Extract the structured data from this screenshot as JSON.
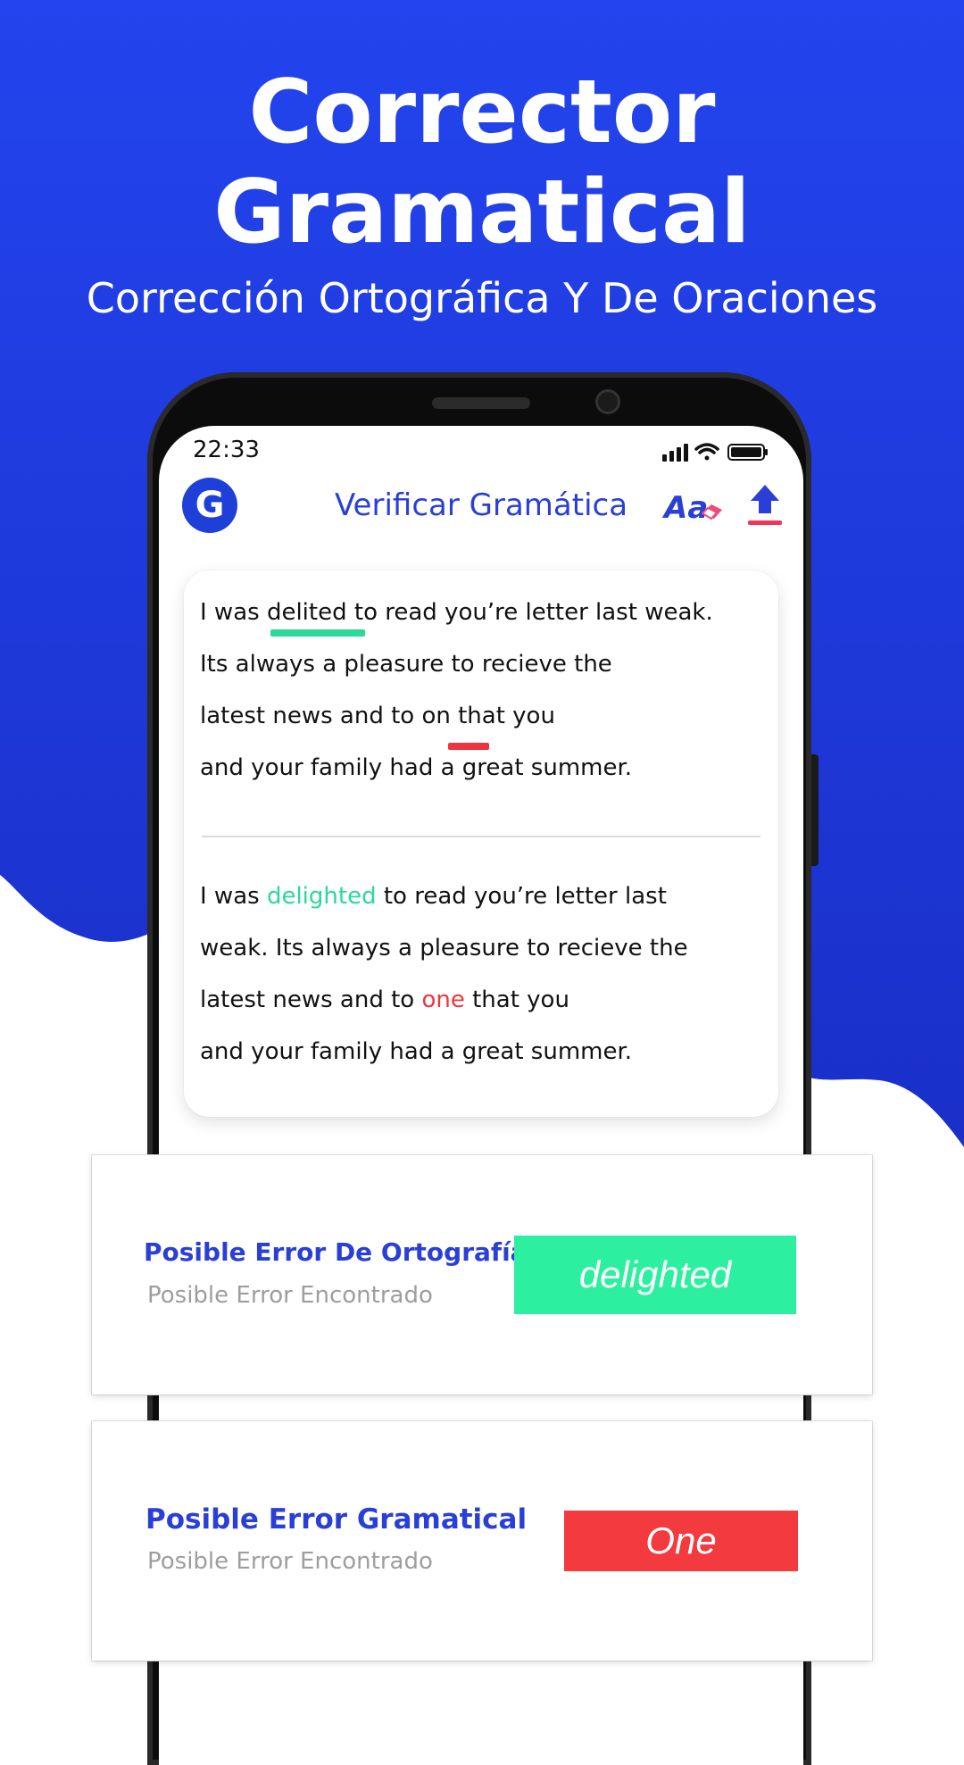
{
  "hero": {
    "title_line1": "Corrector",
    "title_line2": "Gramatical",
    "subtitle": "Corrección Ortográfica Y De Oraciones"
  },
  "status": {
    "time": "22:33"
  },
  "app": {
    "logo": "G",
    "title": "Verificar Gramática",
    "font_icon_label": "Aa"
  },
  "original": {
    "l1_a": "I was ",
    "l1_b": "delited",
    "l1_c": " to read you’re letter last weak.",
    "l2": "Its always a pleasure to recieve the",
    "l3_a": "latest news and to ",
    "l3_b": "on",
    "l3_c": " that you",
    "l4": "and your family had a great summer."
  },
  "corrected": {
    "l1_a": "I was ",
    "l1_b": "delighted",
    "l1_c": " to read you’re letter last",
    "l2": "weak. Its always a pleasure to recieve the",
    "l3_a": "latest news and to ",
    "l3_b": "one",
    "l3_c": " that you",
    "l4": "and your family had a great summer."
  },
  "results": [
    {
      "title": "Posible Error De Ortografía",
      "subtitle": "Posible Error Encontrado",
      "suggestion": "delighted"
    },
    {
      "title": "Posible Error Gramatical",
      "subtitle": "Posible Error Encontrado",
      "suggestion": "One"
    }
  ],
  "colors": {
    "brand_blue": "#1f3fd9",
    "success_green": "#2cf0a0",
    "error_red": "#f23a3f"
  }
}
